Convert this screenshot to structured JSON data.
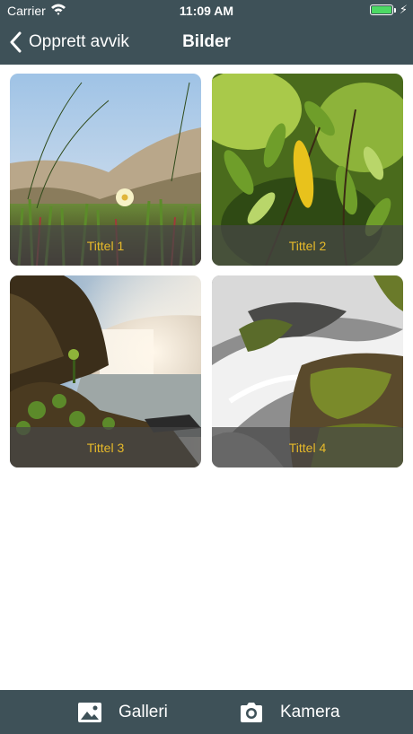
{
  "status_bar": {
    "carrier": "Carrier",
    "time": "11:09 AM"
  },
  "nav": {
    "back_label": "Opprett avvik",
    "title": "Bilder"
  },
  "images": [
    {
      "caption": "Tittel 1"
    },
    {
      "caption": "Tittel 2"
    },
    {
      "caption": "Tittel 3"
    },
    {
      "caption": "Tittel 4"
    }
  ],
  "toolbar": {
    "gallery_label": "Galleri",
    "camera_label": "Kamera"
  },
  "colors": {
    "bar": "#3e5158",
    "caption_text": "#e6b92a",
    "battery": "#4cd964"
  },
  "icons": {
    "back": "chevron-left-icon",
    "gallery": "photo-icon",
    "camera": "camera-icon",
    "wifi": "wifi-icon",
    "battery": "battery-icon",
    "charging": "bolt-icon"
  }
}
